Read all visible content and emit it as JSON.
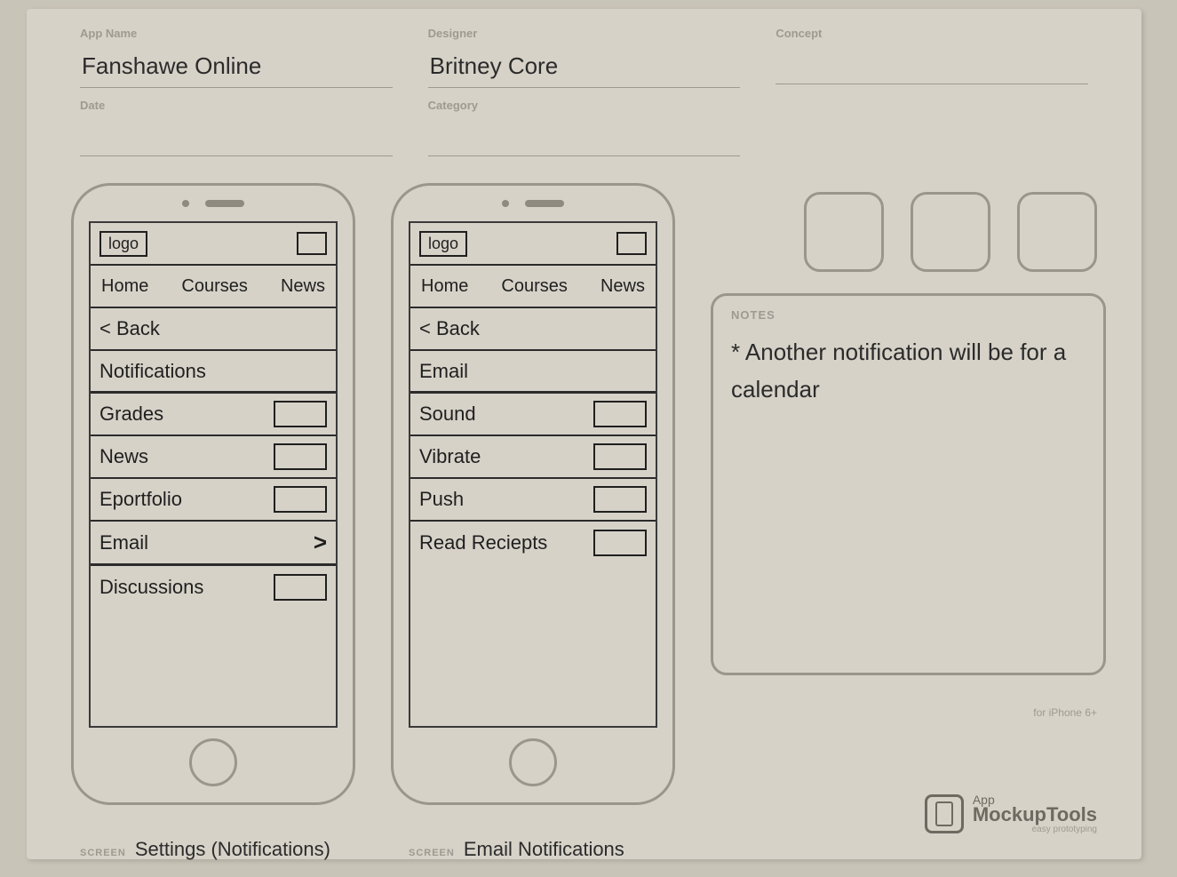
{
  "meta": {
    "app_name_label": "App Name",
    "app_name_value": "Fanshawe Online",
    "designer_label": "Designer",
    "designer_value": "Britney Core",
    "concept_label": "Concept",
    "concept_value": "",
    "date_label": "Date",
    "date_value": "",
    "category_label": "Category",
    "category_value": ""
  },
  "screen1": {
    "logo": "logo",
    "nav": {
      "home": "Home",
      "courses": "Courses",
      "news": "News"
    },
    "back": "< Back",
    "title": "Notifications",
    "items": [
      {
        "label": "Grades",
        "control": "toggle"
      },
      {
        "label": "News",
        "control": "toggle"
      },
      {
        "label": "Eportfolio",
        "control": "toggle"
      },
      {
        "label": "Email",
        "control": "chevron"
      },
      {
        "label": "Discussions",
        "control": "toggle"
      }
    ],
    "screen_prefix": "SCREEN",
    "screen_name": "Settings (Notifications)"
  },
  "screen2": {
    "logo": "logo",
    "nav": {
      "home": "Home",
      "courses": "Courses",
      "news": "News"
    },
    "back": "< Back",
    "title": "Email",
    "items": [
      {
        "label": "Sound",
        "control": "toggle"
      },
      {
        "label": "Vibrate",
        "control": "toggle"
      },
      {
        "label": "Push",
        "control": "toggle"
      },
      {
        "label": "Read Reciepts",
        "control": "toggle"
      }
    ],
    "screen_prefix": "SCREEN",
    "screen_name": "Email Notifications"
  },
  "notes": {
    "label": "NOTES",
    "text": "* Another notification will be for a calendar"
  },
  "branding": {
    "line1": "App",
    "line2": "MockupTools",
    "line3": "easy prototyping",
    "for_label": "for iPhone 6+"
  }
}
